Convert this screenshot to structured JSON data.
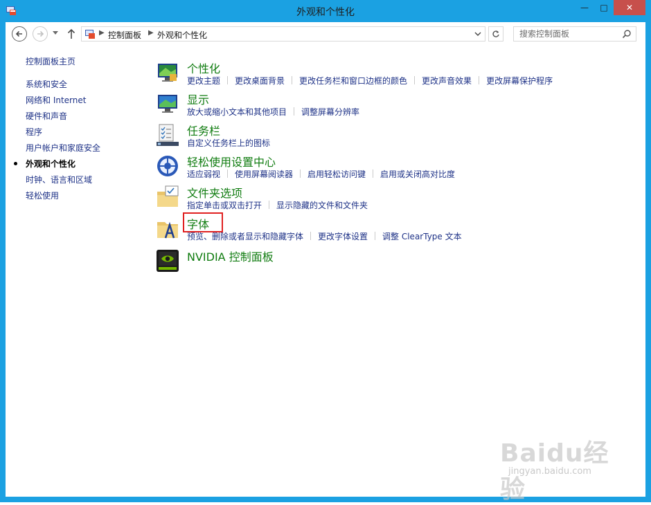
{
  "window": {
    "title": "外观和个性化",
    "minimize_glyph": "—",
    "maximize_glyph": "□",
    "close_glyph": "✕"
  },
  "address": {
    "crumbs": [
      "控制面板",
      "外观和个性化"
    ],
    "separator": "▶"
  },
  "search": {
    "placeholder": "搜索控制面板"
  },
  "leftnav": {
    "items": [
      {
        "label": "控制面板主页"
      },
      {
        "label": "系统和安全"
      },
      {
        "label": "网络和 Internet"
      },
      {
        "label": "硬件和声音"
      },
      {
        "label": "程序"
      },
      {
        "label": "用户帐户和家庭安全"
      },
      {
        "label": "外观和个性化",
        "current": true
      },
      {
        "label": "时钟、语言和区域"
      },
      {
        "label": "轻松使用"
      }
    ]
  },
  "categories": [
    {
      "icon": "personalization-icon",
      "title": "个性化",
      "links": [
        "更改主题",
        "更改桌面背景",
        "更改任务栏和窗口边框的颜色",
        "更改声音效果",
        "更改屏幕保护程序"
      ]
    },
    {
      "icon": "display-icon",
      "title": "显示",
      "links": [
        "放大或缩小文本和其他项目",
        "调整屏幕分辨率"
      ]
    },
    {
      "icon": "taskbar-icon",
      "title": "任务栏",
      "links": [
        "自定义任务栏上的图标"
      ]
    },
    {
      "icon": "ease-of-access-icon",
      "title": "轻松使用设置中心",
      "links": [
        "适应弱视",
        "使用屏幕阅读器",
        "启用轻松访问键",
        "启用或关闭高对比度"
      ]
    },
    {
      "icon": "folder-options-icon",
      "title": "文件夹选项",
      "links": [
        "指定单击或双击打开",
        "显示隐藏的文件和文件夹"
      ]
    },
    {
      "icon": "fonts-folder-icon",
      "title": "字体",
      "links": [
        "预览、删除或者显示和隐藏字体",
        "更改字体设置",
        "调整 ClearType 文本"
      ]
    },
    {
      "icon": "nvidia-icon",
      "title": "NVIDIA 控制面板",
      "links": []
    }
  ],
  "watermark": {
    "brand": "Baidu经验",
    "url": "jingyan.baidu.com"
  },
  "colors": {
    "titlebar": "#1ba1e2",
    "close": "#c7504c",
    "category_title": "#107c10",
    "link": "#1e3287",
    "highlight": "#e02020"
  }
}
